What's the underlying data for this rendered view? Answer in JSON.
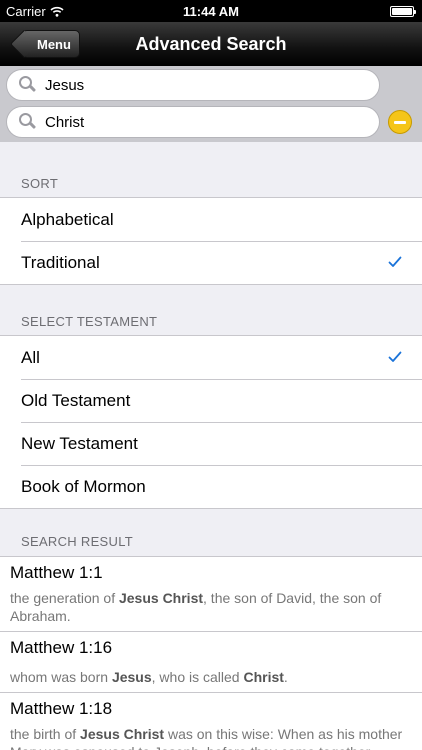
{
  "status": {
    "carrier": "Carrier",
    "time": "11:44 AM"
  },
  "nav": {
    "back_label": "Menu",
    "title": "Advanced Search"
  },
  "search": {
    "term1": "Jesus",
    "term2": "Christ"
  },
  "sort": {
    "header": "SORT",
    "options": [
      "Alphabetical",
      "Traditional"
    ],
    "selected": "Traditional"
  },
  "testament": {
    "header": "SELECT TESTAMENT",
    "options": [
      "All",
      "Old Testament",
      "New Testament",
      "Book of Mormon"
    ],
    "selected": "All"
  },
  "results": {
    "header": "SEARCH RESULT",
    "items": [
      {
        "ref": "Matthew 1:1",
        "parts": [
          [
            "the generation of ",
            false
          ],
          [
            "Jesus Christ",
            true
          ],
          [
            ", the son of David, the son of Abraham.",
            false
          ]
        ]
      },
      {
        "ref": "Matthew 1:16",
        "parts": [
          [
            "whom was born ",
            false
          ],
          [
            "Jesus",
            true
          ],
          [
            ", who is called ",
            false
          ],
          [
            "Christ",
            true
          ],
          [
            ".",
            false
          ]
        ]
      },
      {
        "ref": "Matthew 1:18",
        "parts": [
          [
            "the birth of ",
            false
          ],
          [
            "Jesus Christ",
            true
          ],
          [
            " was on this wise: When as his mother Mary was espoused to Joseph, before they came together",
            false
          ]
        ]
      }
    ]
  },
  "colors": {
    "accent": "#1a73d9",
    "remove": "#f5c518"
  }
}
